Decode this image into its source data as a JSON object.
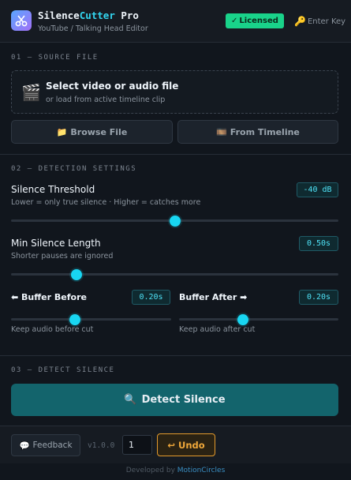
{
  "header": {
    "title_part1": "Silence",
    "title_part2": "Cutter",
    "title_part3": " Pro",
    "subtitle": "YouTube / Talking Head Editor",
    "licensed_label": "Licensed",
    "enter_key_label": "Enter Key"
  },
  "source": {
    "section_label": "01 — SOURCE FILE",
    "drop_title": "Select video or audio file",
    "drop_sub": "or load from active timeline clip",
    "browse_label": "Browse File",
    "timeline_label": "From Timeline"
  },
  "detection": {
    "section_label": "02 — DETECTION SETTINGS",
    "threshold": {
      "title": "Silence Threshold",
      "help": "Lower = only true silence  ·  Higher = catches more",
      "value": "-40 dB",
      "level": 0.5
    },
    "min_length": {
      "title": "Min Silence Length",
      "help": "Shorter pauses are ignored",
      "value": "0.50s",
      "level": 0.2
    },
    "buffer_before": {
      "title": "⬅ Buffer Before",
      "help": "Keep audio before cut",
      "value": "0.20s",
      "level": 0.4
    },
    "buffer_after": {
      "title": "Buffer After ➡",
      "help": "Keep audio after cut",
      "value": "0.20s",
      "level": 0.4
    }
  },
  "detect": {
    "section_label": "03 — DETECT SILENCE",
    "button_label": "Detect Silence"
  },
  "footer": {
    "feedback_label": "Feedback",
    "version": "v1.0.0",
    "undo_steps": "1",
    "undo_label": "Undo",
    "credit_prefix": "Developed by ",
    "credit_link": "MotionCircles"
  },
  "colors": {
    "accent": "#18d6f2",
    "licensed": "#19d38a",
    "undo": "#e39a2c",
    "detect_button": "#13646c"
  },
  "icons": {
    "logo": "scissors-icon",
    "licensed": "checkmark-icon",
    "enter_key": "key-icon",
    "drop": "clapperboard-icon",
    "browse": "folder-icon",
    "timeline": "film-icon",
    "detect": "magnifier-icon",
    "feedback": "speech-bubble-icon",
    "undo": "undo-arrow-icon"
  }
}
